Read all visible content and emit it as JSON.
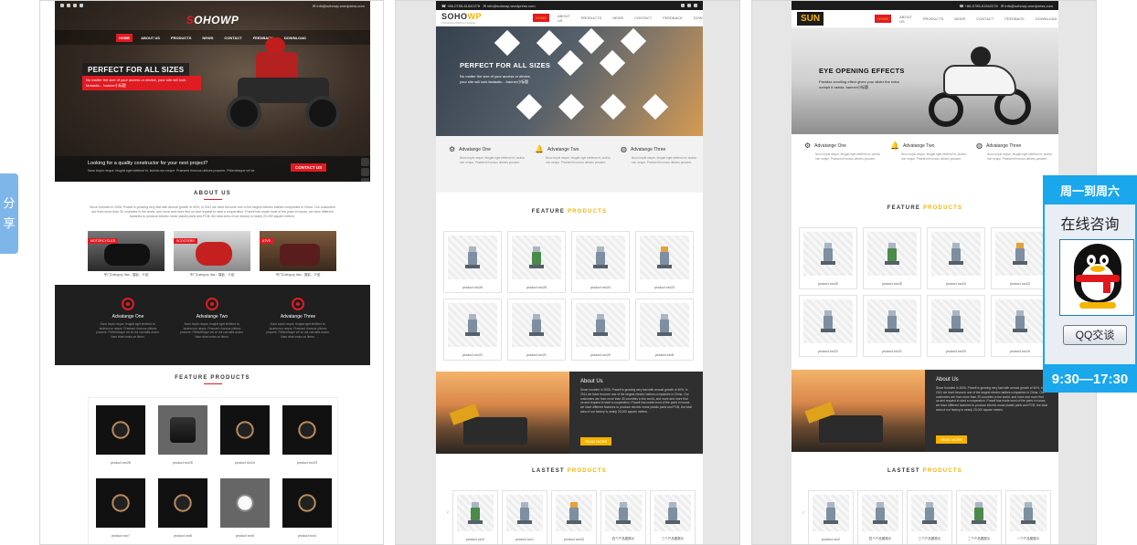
{
  "share_tab": {
    "label": "分享"
  },
  "qq_widget": {
    "header": "周一到周六",
    "title": "在线咨询",
    "button": "QQ交谈",
    "hours": "9:30—17:30"
  },
  "theme1": {
    "logo_a": "S",
    "logo_b": "OHOWP",
    "nav": [
      "HOME",
      "ABOUT US",
      "PRODUCTS",
      "NEWS",
      "CONTACT",
      "FEEDBACK",
      "DOWNLOAD"
    ],
    "hero_title": "PERFECT FOR ALL SIZES",
    "hero_sub": "No matter the size of your access or device, your site will look fantastic... banner小标题",
    "cta_text": "Looking for a quality constructor for your next project?",
    "cta_sub": "Nunc turpis neque, feugiat eget eleifend et, lacinia non neque. Praesent rhoncus ultrices posuere. Pellentesque vel se",
    "cta_button": "CONTACT US",
    "about_title": "ABOUT US",
    "about_text": "Since founded in 2006, Powell is growing very fast with annual growth of 40%, in 2011 we have become one of the largest electric bathes companies in China. Our customers are from more than 30 countries in the world, and more and more find us and request to start a cooperation. Powell has made most of the parts in house, we have different factories to produce electric motor plastic parts and PCB, the total area of our factory is nearly 20,000 square meters.",
    "categories": [
      {
        "tag": "MOTORCYCLES",
        "caption": "专门Category Itas：摄影，介绍"
      },
      {
        "tag": "SCOOTERS",
        "caption": "专门Category Itas：摄影，介绍"
      },
      {
        "tag": "ATVS",
        "caption": "专门Category Itas：摄影，介绍"
      }
    ],
    "advantages": [
      {
        "title": "Advatange One",
        "desc": "Nunc turpis neque, feugiat eget eleifend et, lacinia non neque. Praesent rhoncus ultrices posuere. Pellentesque vel se dui convallis auctor. Nam vitae lectus se libero."
      },
      {
        "title": "Advatange Two",
        "desc": "Nunc turpis neque, feugiat eget eleifend et, lacinia non neque. Praesent rhoncus ultrices posuere. Pellentesque vel se dui convallis auctor. Nam vitae lectus se libero."
      },
      {
        "title": "Advatange Three",
        "desc": "Nunc turpis neque, feugiat eget eleifend et, lacinia non neque. Praesent rhoncus ultrices posuere. Pellentesque vel se dui convallis auctor. Nam vitae lectus se libero."
      }
    ],
    "featured_title": "FEATURE PRODUCTS",
    "products": [
      "product xxx26",
      "product xxx25",
      "product xxx24",
      "product xxx23",
      "product xxx7",
      "product xxx6",
      "product xxx5",
      "product xxx4"
    ]
  },
  "theme2": {
    "logo_a": "SOHO",
    "logo_b": "WP",
    "logo_tag": "Professional Platform Supplier",
    "nav": [
      "HOME",
      "ABOUT US",
      "PRODUCTS",
      "NEWS",
      "CONTACT",
      "FEEDBACK",
      "DOWNLOAD"
    ],
    "hero_title": "PERFECT FOR ALL SIZES",
    "hero_sub": "No matter the size of your access or device, your site will look fantastic... banner小标题",
    "advantages": [
      {
        "title": "Advatange One",
        "desc": "Nunc turpis neque, feugiat eget eleifend et, lacinia non neque. Praesent rhoncus ultrices posuere."
      },
      {
        "title": "Advatange Two",
        "desc": "Nunc turpis neque, feugiat eget eleifend et, lacinia non neque. Praesent rhoncus ultrices posuere."
      },
      {
        "title": "Advatange Three",
        "desc": "Nunc turpis neque, feugiat eget eleifend et, lacinia non neque. Praesent rhoncus ultrices posuere."
      }
    ],
    "featured_title_a": "FEATURE ",
    "featured_title_b": "PRODUCTS",
    "products": [
      "product xxx26",
      "product xxx25",
      "product xxx24",
      "product xxx23",
      "product xxx22",
      "product xxx21",
      "product xxx20",
      "product xxx8"
    ],
    "about_title": "About Us",
    "about_text": "Since founded in 2006, Powell is growing very fast with annual growth of 40%, in 2011 we have become one of the largest electric bathes companies in China. Our customers are from more than 30 countries in the world, and more and more find us and request to start a cooperation. Powell has made most of the parts in house, we have different factories to produce electric motor plastic parts and PCB, the total area of our factory is nearly 20,000 square meters.",
    "about_button": "READ MORE",
    "latest_title_a": "LASTEST ",
    "latest_title_b": "PRODUCTS",
    "latest": [
      "product xxx2",
      "product xxx1",
      "product xxx23",
      "四个产品图展示",
      "三个产品图展示"
    ]
  },
  "theme3": {
    "logo": "SUN",
    "nav": [
      "HOME",
      "ABOUT US",
      "PRODUCTS",
      "NEWS",
      "CONTACT",
      "FEEDBACK",
      "DOWNLOAD"
    ],
    "hero_title": "EYE OPENING EFFECTS",
    "hero_sub": "Parallax scrolling effect gives your slider the extra oomph it needs. banner小标题",
    "advantages": [
      {
        "title": "Advatange One",
        "desc": "Nunc turpis neque, feugiat eget eleifend et, lacinia non neque. Praesent rhoncus ultrices posuere."
      },
      {
        "title": "Advatange Two",
        "desc": "Nunc turpis neque, feugiat eget eleifend et, lacinia non neque. Praesent rhoncus ultrices posuere."
      },
      {
        "title": "Advatange Three",
        "desc": "Nunc turpis neque, feugiat eget eleifend et, lacinia non neque. Praesent rhoncus ultrices posuere."
      }
    ],
    "featured_title_a": "FEATURE ",
    "featured_title_b": "PRODUCTS",
    "products": [
      "product xxx26",
      "product xxx25",
      "product xxx24",
      "product xxx23",
      "product xxx22",
      "product xxx21",
      "product xxx20",
      "product xxx19"
    ],
    "about_title": "About Us",
    "about_text": "Since founded in 2006, Powell is growing very fast with annual growth of 40%, in 2011 we have become one of the largest electric bathes companies in China. Our customers are from more than 30 countries in the world, and more and more find us and request to start a cooperation. Powell has made most of the parts in house, we have different factories to produce electric motor plastic parts and PCB, the total area of our factory is nearly 20,000 square meters.",
    "about_button": "READ MORE",
    "latest_title_a": "LASTEST ",
    "latest_title_b": "PRODUCTS",
    "latest": [
      "product xxx2",
      "四个产品图展示",
      "三个产品图展示",
      "二个产品图展示",
      "一个产品图展示"
    ]
  },
  "colors": {
    "brand_red": "#e11b22",
    "accent_yellow": "#f5b300",
    "qq_blue": "#1aa7ec"
  }
}
